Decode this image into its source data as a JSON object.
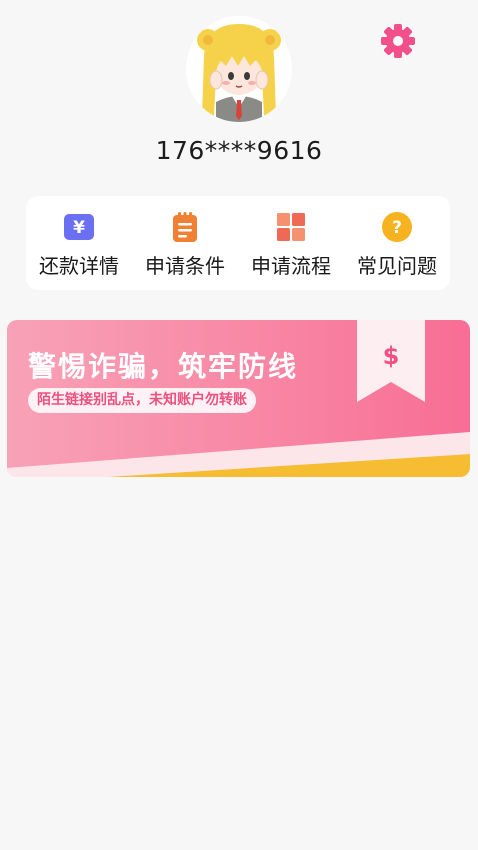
{
  "header": {
    "settings_icon": "gear-icon",
    "avatar_icon": "anime-girl-avatar",
    "phone": "176****9616"
  },
  "menu": [
    {
      "label": "还款详情",
      "icon": "yuan-icon",
      "color": "#6b6ff2"
    },
    {
      "label": "申请条件",
      "icon": "notepad-icon",
      "color": "#f08033"
    },
    {
      "label": "申请流程",
      "icon": "grid-icon",
      "color": "#f2765e"
    },
    {
      "label": "常见问题",
      "icon": "question-icon",
      "color": "#f7b21f"
    }
  ],
  "banner": {
    "title": "警惕诈骗，筑牢防线",
    "subtitle": "陌生链接别乱点，未知账户勿转账",
    "tag_symbol": "$"
  },
  "colors": {
    "accent": "#f34f86",
    "background": "#f7f7f7"
  }
}
